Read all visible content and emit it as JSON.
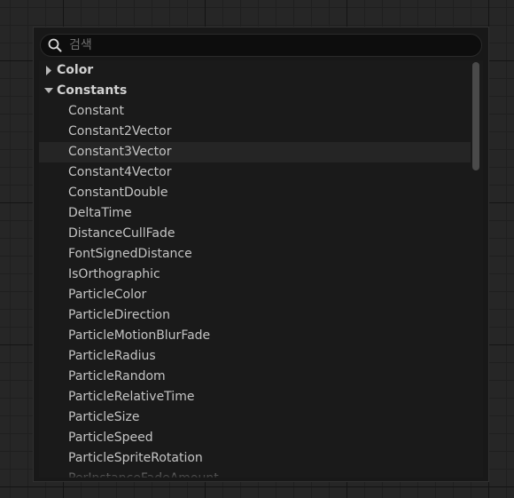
{
  "search": {
    "placeholder": "검색",
    "value": ""
  },
  "categories": [
    {
      "label": "Color",
      "expanded": false
    },
    {
      "label": "Constants",
      "expanded": true
    }
  ],
  "constants_items": [
    "Constant",
    "Constant2Vector",
    "Constant3Vector",
    "Constant4Vector",
    "ConstantDouble",
    "DeltaTime",
    "DistanceCullFade",
    "FontSignedDistance",
    "IsOrthographic",
    "ParticleColor",
    "ParticleDirection",
    "ParticleMotionBlurFade",
    "ParticleRadius",
    "ParticleRandom",
    "ParticleRelativeTime",
    "ParticleSize",
    "ParticleSpeed",
    "ParticleSpriteRotation",
    "PerInstanceFadeAmount"
  ],
  "hovered_item": "Constant3Vector",
  "icons": {
    "search": "search-icon",
    "collapsed": "triangle-right-icon",
    "expanded": "triangle-down-icon"
  },
  "colors": {
    "panel_bg": "#181818",
    "list_bg": "#1a1a1a",
    "hover_bg": "#252525",
    "text": "#c4c4c4",
    "scroll_thumb": "#4a4a4a"
  }
}
